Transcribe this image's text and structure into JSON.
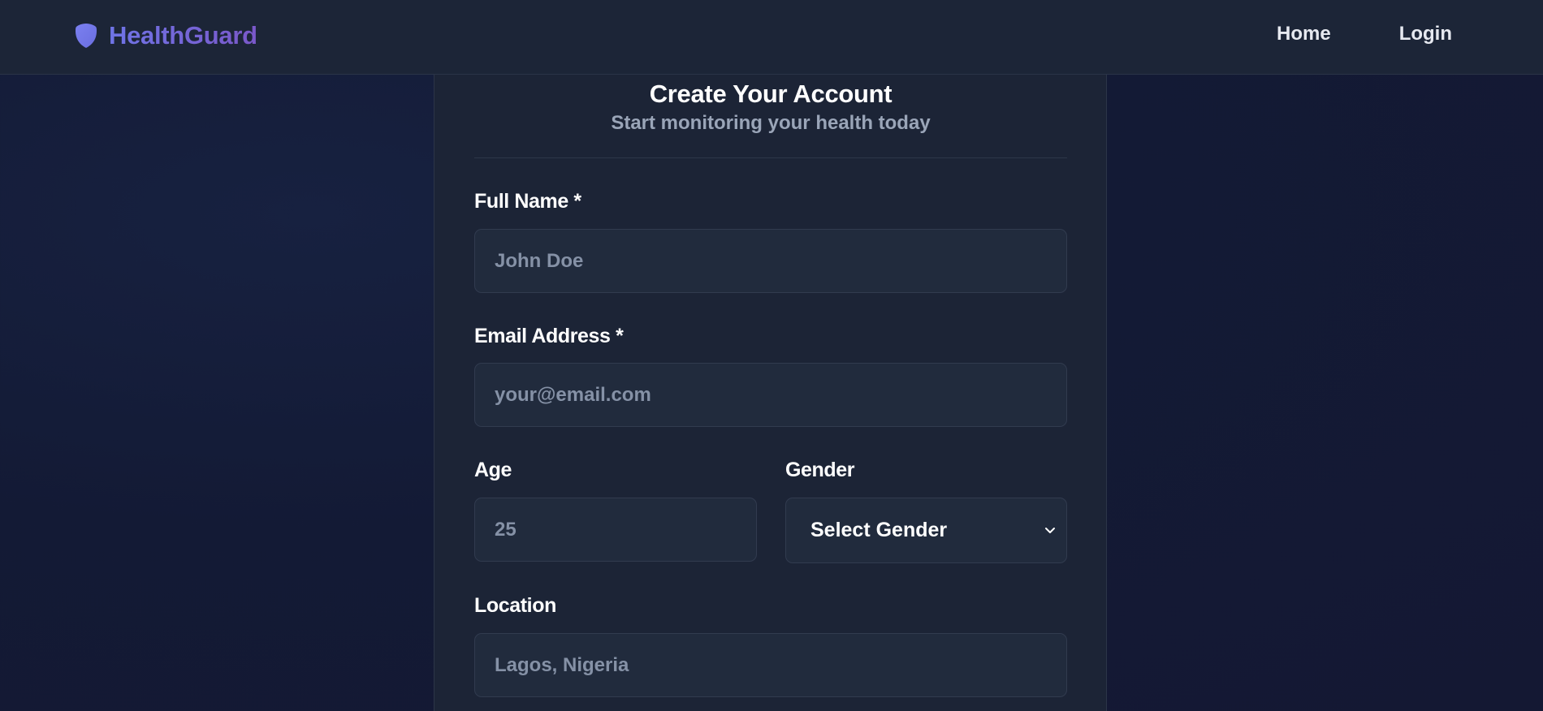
{
  "nav": {
    "brand": "HealthGuard",
    "links": [
      "Home",
      "Login"
    ]
  },
  "form": {
    "title": "Create Your Account",
    "subtitle": "Start monitoring your health today",
    "full_name": {
      "label": "Full Name *",
      "placeholder": "John Doe"
    },
    "email": {
      "label": "Email Address *",
      "placeholder": "your@email.com"
    },
    "age": {
      "label": "Age",
      "placeholder": "25"
    },
    "gender": {
      "label": "Gender",
      "selected": "Select Gender"
    },
    "location": {
      "label": "Location",
      "placeholder": "Lagos, Nigeria"
    }
  },
  "icons": {
    "brand": "shield-icon",
    "gender_select": "chevron-down-icon"
  },
  "colors": {
    "brand_gradient_start": "#6f74e6",
    "brand_gradient_end": "#7a58c9",
    "navbar_bg": "#1c2537",
    "card_bg": "#1c2436",
    "input_bg": "#212b3d",
    "page_bg": "#141a35"
  }
}
